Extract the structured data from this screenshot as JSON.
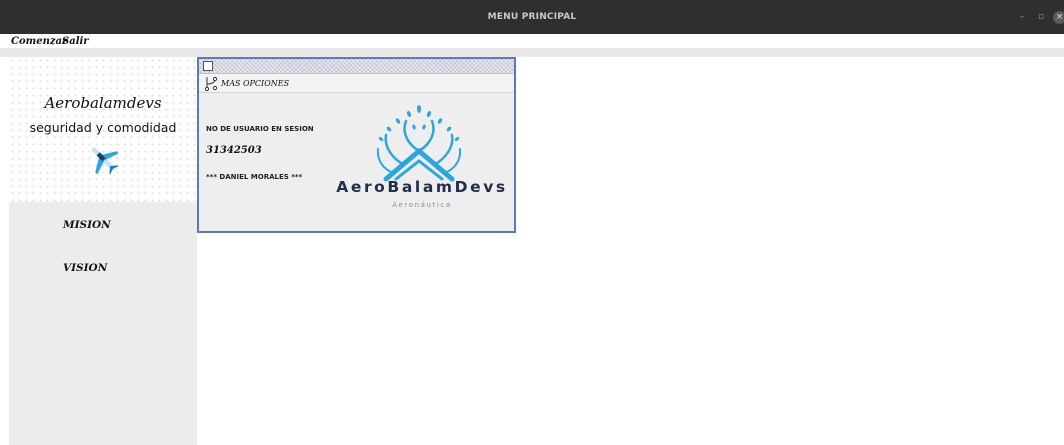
{
  "window": {
    "title": "MENU PRINCIPAL",
    "controls": {
      "minimize": "–",
      "maximize": "▫",
      "close": "×"
    }
  },
  "menubar": {
    "items": [
      "Comenzar",
      "Salir"
    ]
  },
  "sidebar": {
    "brand_script": "Aerobalamdevs",
    "tagline": "seguridad y comodidad",
    "nav": [
      "MISION",
      "VISION"
    ],
    "icon": "airplane-icon"
  },
  "internal_frame": {
    "menu_label": "MAS OPCIONES",
    "menu_icon": "branch-icon",
    "user_label": "NO DE USUARIO EN SESION",
    "user_id": "31342503",
    "user_name": "*** DANIEL MORALES ***",
    "company_name": "AeroBalamDevs",
    "company_subtitle": "Aeronáutica"
  },
  "colors": {
    "titlebar": "#2f2f2f",
    "frame_border": "#5b78b7",
    "logo_blue": "#2aa6e0",
    "company_text": "#1f2e4f"
  }
}
